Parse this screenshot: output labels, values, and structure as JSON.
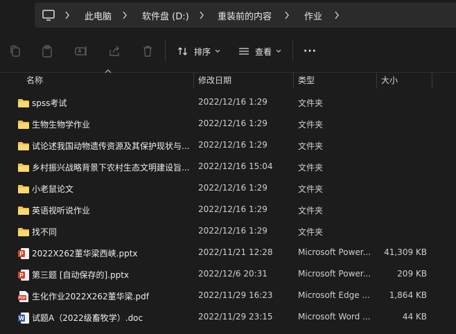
{
  "breadcrumb": {
    "items": [
      "此电脑",
      "软件盘 (D:)",
      "重装前的内容",
      "作业"
    ]
  },
  "toolbar": {
    "sort_label": "排序",
    "view_label": "查看",
    "more_label": "···"
  },
  "columns": {
    "name": "名称",
    "date": "修改日期",
    "type": "类型",
    "size": "大小"
  },
  "files": [
    {
      "icon": "folder-icon",
      "name": "spss考试",
      "date": "2022/12/16 1:29",
      "type": "文件夹",
      "size": ""
    },
    {
      "icon": "folder-icon",
      "name": "生物生物学作业",
      "date": "2022/12/16 1:29",
      "type": "文件夹",
      "size": ""
    },
    {
      "icon": "folder-icon",
      "name": "试论述我国动物遗传资源及其保护现状与...",
      "date": "2022/12/16 1:29",
      "type": "文件夹",
      "size": ""
    },
    {
      "icon": "folder-icon",
      "name": "乡村振兴战略背景下农村生态文明建设旨...",
      "date": "2022/12/16 15:04",
      "type": "文件夹",
      "size": ""
    },
    {
      "icon": "folder-icon",
      "name": "小老鼠论文",
      "date": "2022/12/16 1:29",
      "type": "文件夹",
      "size": ""
    },
    {
      "icon": "folder-icon",
      "name": "英语视听说作业",
      "date": "2022/12/16 1:29",
      "type": "文件夹",
      "size": ""
    },
    {
      "icon": "folder-icon",
      "name": "找不同",
      "date": "2022/12/16 1:29",
      "type": "文件夹",
      "size": ""
    },
    {
      "icon": "pptx-icon",
      "name": "2022X262董华梁西峡.pptx",
      "date": "2022/11/21 12:28",
      "type": "Microsoft Power...",
      "size": "41,309 KB"
    },
    {
      "icon": "pptx-icon",
      "name": "第三题 [自动保存的].pptx",
      "date": "2022/12/6 20:31",
      "type": "Microsoft Power...",
      "size": "209 KB"
    },
    {
      "icon": "pdf-icon",
      "name": "生化作业2022X262董华梁.pdf",
      "date": "2022/11/29 16:23",
      "type": "Microsoft Edge ...",
      "size": "1,864 KB"
    },
    {
      "icon": "docx-icon",
      "name": "试题A（2022级畜牧学）.doc",
      "date": "2022/11/29 23:15",
      "type": "Microsoft Word ...",
      "size": "44 KB"
    }
  ],
  "colors": {
    "background": "#1c1c1c",
    "folder": "#f4c542",
    "pptx": "#d24726",
    "pdf": "#d93025",
    "docx": "#2b579a"
  }
}
